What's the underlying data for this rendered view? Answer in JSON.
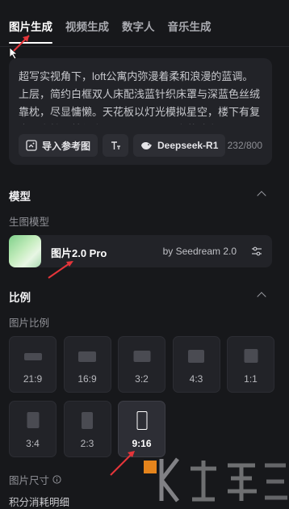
{
  "tabs": [
    {
      "label": "图片生成",
      "active": true
    },
    {
      "label": "视频生成",
      "active": false
    },
    {
      "label": "数字人",
      "active": false
    },
    {
      "label": "音乐生成",
      "active": false
    }
  ],
  "prompt": {
    "text": "超写实视角下，loft公寓内弥漫着柔和浪漫的蓝调。上层，简约白框双人床配浅蓝针织床罩与深蓝色丝绒靠枕，尽显慵懒。天花板以灯光模拟星空，楼下有复古沙发椅，梦幻空间，下层一个公寓落地窗",
    "tools": {
      "reference_label": "导入参考图",
      "model_label": "Deepseek-R1"
    },
    "counter": "232/800"
  },
  "model_section": {
    "title": "模型",
    "sub_label": "生图模型",
    "model_name": "图片2.0 Pro",
    "provider": "by Seedream 2.0"
  },
  "ratio_section": {
    "title": "比例",
    "sub_label": "图片比例",
    "selected": "9:16",
    "ratios": [
      "21:9",
      "16:9",
      "3:2",
      "4:3",
      "1:1",
      "3:4",
      "2:3",
      "9:16"
    ]
  },
  "bottom": {
    "size_label": "图片尺寸",
    "credits_label": "积分消耗明细"
  },
  "colors": {
    "background": "#17181b",
    "card": "#222328",
    "annotation_arrow": "#e5353a",
    "watermark_orange": "#f08a1c"
  },
  "icons": [
    "image-upload-icon",
    "text-format-icon",
    "deepseek-whale-icon",
    "chevron-up-icon",
    "sliders-icon",
    "info-icon"
  ]
}
